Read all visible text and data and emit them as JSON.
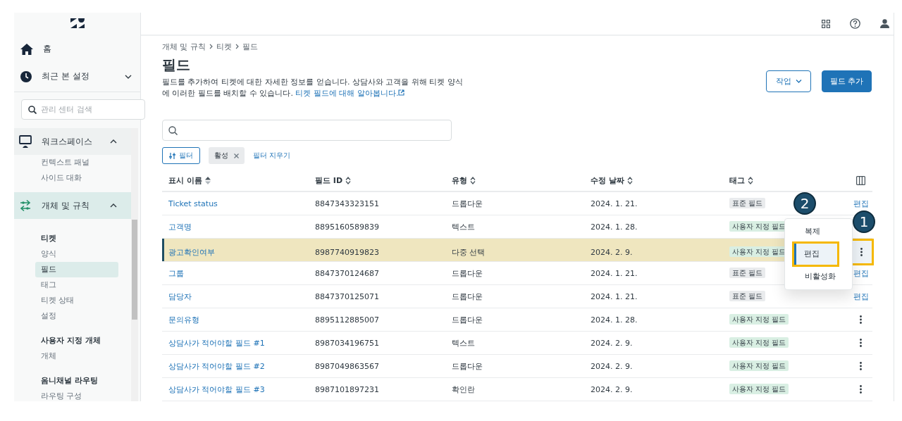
{
  "sidebar": {
    "nav": [
      {
        "label": "홈"
      },
      {
        "label": "최근 본 설정",
        "expanded": false
      }
    ],
    "search": {
      "placeholder": "관리 센터 검색"
    },
    "sections": [
      {
        "label": "워크스페이스",
        "expanded": true,
        "selected": false,
        "groups": [
          {
            "items": [
              {
                "label": "컨텍스트 패널",
                "selected": false
              },
              {
                "label": "사이드 대화",
                "selected": false
              }
            ]
          }
        ]
      },
      {
        "label": "개체 및 규칙",
        "expanded": true,
        "selected": true,
        "groups": [
          {
            "title": "티켓",
            "items": [
              {
                "label": "양식",
                "selected": false
              },
              {
                "label": "필드",
                "selected": true
              },
              {
                "label": "태그",
                "selected": false
              },
              {
                "label": "티켓 상태",
                "selected": false
              },
              {
                "label": "설정",
                "selected": false
              }
            ]
          },
          {
            "title": "사용자 지정 개체",
            "items": [
              {
                "label": "개체",
                "selected": false
              }
            ]
          },
          {
            "title": "옴니채널 라우팅",
            "items": [
              {
                "label": "라우팅 구성",
                "selected": false
              }
            ]
          }
        ]
      }
    ]
  },
  "breadcrumbs": [
    "개체 및 규칙",
    "티켓",
    "필드"
  ],
  "title": "필드",
  "description": {
    "text": "필드를 추가하여 티켓에 대한 자세한 정보를 얻습니다. 상담사와 고객을 위해 티켓 양식에 이러한 필드를 배치할 수 있습니다.",
    "link": "티켓 필드에 대해 알아봅니다."
  },
  "buttons": [
    {
      "label": "작업",
      "kind": "outline"
    },
    {
      "label": "필드 추가",
      "kind": "primary"
    }
  ],
  "filters": {
    "button": "필터",
    "chips": [
      "활성"
    ],
    "clear": "필터 지우기"
  },
  "table": {
    "columns": [
      {
        "label": "표시 이름",
        "sorted": true
      },
      {
        "label": "필드 ID",
        "sorted": false
      },
      {
        "label": "유형",
        "sorted": false
      },
      {
        "label": "수정 날짜",
        "sorted": false
      },
      {
        "label": "태그",
        "sorted": false
      }
    ],
    "rows": [
      {
        "name": "Ticket status",
        "id": "8847343323151",
        "type": "드롭다운",
        "date": "2024. 1. 21.",
        "tag": {
          "label": "표준 필드",
          "kind": "standard"
        },
        "selected": false,
        "action": {
          "kind": "link",
          "label": "편집"
        }
      },
      {
        "name": "고객명",
        "id": "8895160589839",
        "type": "텍스트",
        "date": "2024. 1. 28.",
        "tag": {
          "label": "사용자 지정 필드",
          "kind": "custom"
        },
        "selected": false
      },
      {
        "name": "광고확인여부",
        "id": "8987740919823",
        "type": "다중 선택",
        "date": "2024. 2. 9.",
        "tag": {
          "label": "사용자 지정 필드",
          "kind": "custom"
        },
        "selected": true,
        "action": {
          "kind": "menu",
          "highlighted": true,
          "callout": "1",
          "menu": [
            {
              "label": "복제",
              "selected": false
            },
            {
              "label": "편집",
              "selected": true,
              "highlighted": true,
              "callout": "2"
            },
            {
              "label": "비활성화",
              "selected": false
            }
          ]
        }
      },
      {
        "name": "그룹",
        "id": "8847370124687",
        "type": "드롭다운",
        "date": "2024. 1. 21.",
        "tag": {
          "label": "표준 필드",
          "kind": "standard"
        },
        "selected": false,
        "action": {
          "kind": "link",
          "label": "편집"
        }
      },
      {
        "name": "담당자",
        "id": "8847370125071",
        "type": "드롭다운",
        "date": "2024. 1. 21.",
        "tag": {
          "label": "표준 필드",
          "kind": "standard"
        },
        "selected": false,
        "action": {
          "kind": "link",
          "label": "편집"
        }
      },
      {
        "name": "문의유형",
        "id": "8895112885007",
        "type": "드롭다운",
        "date": "2024. 1. 28.",
        "tag": {
          "label": "사용자 지정 필드",
          "kind": "custom"
        },
        "selected": false,
        "action": {
          "kind": "menu"
        }
      },
      {
        "name": "상담사가 적어야할 필드 #1",
        "id": "8987034196751",
        "type": "텍스트",
        "date": "2024. 2. 9.",
        "tag": {
          "label": "사용자 지정 필드",
          "kind": "custom"
        },
        "selected": false,
        "action": {
          "kind": "menu"
        }
      },
      {
        "name": "상담사가 적어야할 필드 #2",
        "id": "8987049863567",
        "type": "드롭다운",
        "date": "2024. 2. 9.",
        "tag": {
          "label": "사용자 지정 필드",
          "kind": "custom"
        },
        "selected": false,
        "action": {
          "kind": "menu"
        }
      },
      {
        "name": "상담사가 적어야할 필드 #3",
        "id": "8987101897231",
        "type": "확인란",
        "date": "2024. 2. 9.",
        "tag": {
          "label": "사용자 지정 필드",
          "kind": "custom"
        },
        "selected": false,
        "action": {
          "kind": "menu"
        }
      }
    ]
  }
}
